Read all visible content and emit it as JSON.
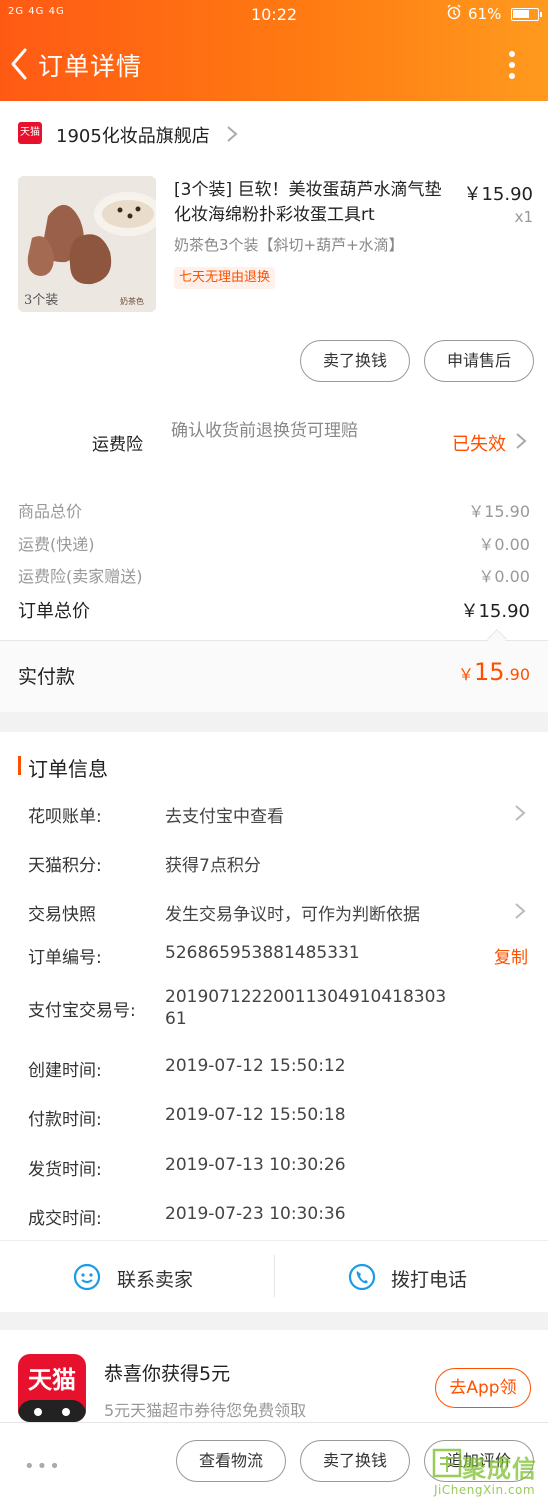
{
  "status_bar": {
    "signal": "2G 4G 4G",
    "time": "10:22",
    "battery": "61%"
  },
  "header": {
    "title": "订单详情"
  },
  "shop": {
    "logo_text": "天猫",
    "name": "1905化妆品旗舰店"
  },
  "product": {
    "image_text": "3个装",
    "image_tag": "奶茶色",
    "title": "[3个装] 巨软！美妆蛋葫芦水滴气垫化妆海绵粉扑彩妆蛋工具rt",
    "price": "￥15.90",
    "qty": "x1",
    "sku": "奶茶色3个装【斜切+葫芦+水滴】",
    "tag": "七天无理由退换"
  },
  "actions": {
    "sell_swap": "卖了换钱",
    "after_sale": "申请售后"
  },
  "insurance": {
    "label": "运费险",
    "desc": "确认收货前退换货可理赔",
    "status": "已失效"
  },
  "summary": {
    "rows": [
      {
        "label": "商品总价",
        "value": "￥15.90"
      },
      {
        "label": "运费(快递)",
        "value": "￥0.00"
      },
      {
        "label": "运费险(卖家赠送)",
        "value": "￥0.00"
      }
    ],
    "total_label": "订单总价",
    "total_value": "￥15.90",
    "paid_label": "实付款",
    "paid_symbol": "￥",
    "paid_int": "15",
    "paid_dec": ".90"
  },
  "order_info": {
    "title": "订单信息",
    "rows": [
      {
        "label": "花呗账单:",
        "value": "去支付宝中查看"
      },
      {
        "label": "天猫积分:",
        "value": "获得7点积分"
      },
      {
        "label": "交易快照",
        "value": "发生交易争议时，可作为判断依据"
      },
      {
        "label": "订单编号:",
        "value": "526865953881485331"
      },
      {
        "label": "支付宝交易号:",
        "value": "20190712220011304910418303",
        "value2": "61"
      },
      {
        "label": "创建时间:",
        "value": "2019-07-12 15:50:12"
      },
      {
        "label": "付款时间:",
        "value": "2019-07-12 15:50:18"
      },
      {
        "label": "发货时间:",
        "value": "2019-07-13 10:30:26"
      },
      {
        "label": "成交时间:",
        "value": "2019-07-23 10:30:36"
      }
    ],
    "copy_label": "复制"
  },
  "contact": {
    "seller": "联系卖家",
    "call": "拨打电话"
  },
  "promo": {
    "logo_text": "天猫",
    "title": "恭喜你获得5元",
    "subtitle": "5元天猫超市券待您免费领取",
    "button": "去App领"
  },
  "bottom_bar": {
    "more": "•••",
    "logistics": "查看物流",
    "sell_swap": "卖了换钱",
    "review": "追加评价"
  },
  "watermark": {
    "text": "聚成信",
    "url": "JiChengXin.com"
  },
  "colors": {
    "accent": "#ff5000",
    "header_start": "#ff5a14",
    "header_end": "#ff9a1e",
    "tmall_red": "#e8112d"
  }
}
